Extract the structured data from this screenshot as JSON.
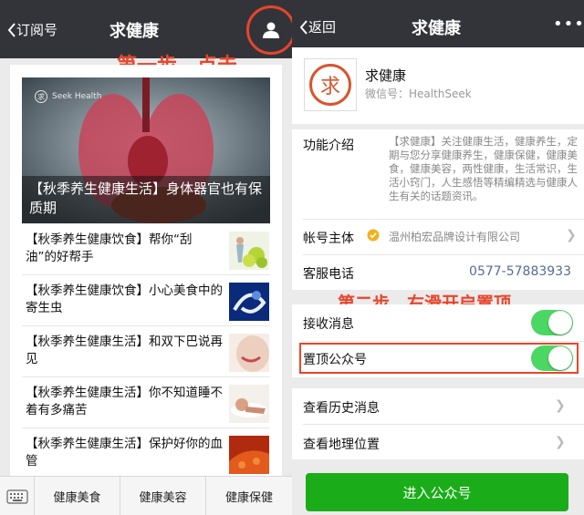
{
  "left": {
    "nav": {
      "back_label": "订阅号",
      "title": "求健康"
    },
    "annotation_step1": "第一步，点击",
    "feature": {
      "brand": "Seek Health",
      "caption": "【秋季养生健康生活】身体器官也有保质期"
    },
    "articles": [
      {
        "title": "【秋季养生健康饮食】帮你“刮油”的好帮手"
      },
      {
        "title": "【秋季养生健康饮食】小心美食中的寄生虫"
      },
      {
        "title": "【秋季养生健康生活】和双下巴说再见"
      },
      {
        "title": "【秋季养生健康生活】你不知道睡不着有多痛苦"
      },
      {
        "title": "【秋季养生健康生活】保护好你的血管"
      }
    ],
    "bottom_menu": [
      "健康美食",
      "健康美容",
      "健康保健"
    ]
  },
  "right": {
    "nav": {
      "back_label": "返回",
      "title": "求健康",
      "more": "•••"
    },
    "profile": {
      "logo_char": "求",
      "name": "求健康",
      "wechat_id": "微信号：HealthSeek"
    },
    "intro": {
      "label": "功能介绍",
      "text": "【求健康】关注健康生活，健康养生，定期与您分享健康养生，健康保健，健康美食，健康美容，两性健康，生活常识，生活小窍门，人生感悟等精编精选与健康人生有关的话题资讯。"
    },
    "account_owner": {
      "label": "帐号主体",
      "value": "温州柏宏品牌设计有限公司"
    },
    "service_phone": {
      "label": "客服电话",
      "value": "0577-57883933"
    },
    "annotation_step2": "第二步，右滑开启置顶",
    "toggles": [
      {
        "label": "接收消息",
        "on": true
      },
      {
        "label": "置顶公众号",
        "on": true
      }
    ],
    "links": [
      {
        "label": "查看历史消息"
      },
      {
        "label": "查看地理位置"
      }
    ],
    "enter_button": "进入公众号",
    "colors": {
      "accent": "#1aad19",
      "toggle_on": "#4bd763",
      "annotation": "#e8452c"
    }
  }
}
